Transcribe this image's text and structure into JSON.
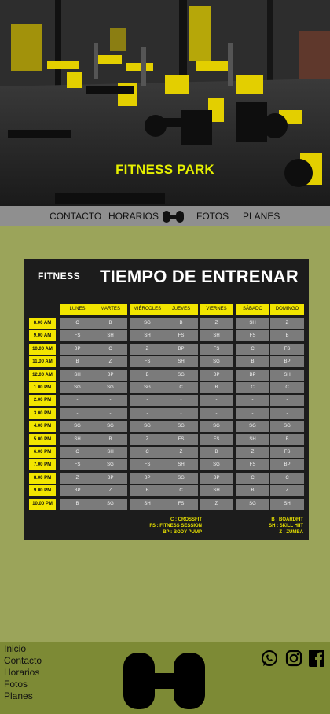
{
  "hero": {
    "title": "FITNESS PARK"
  },
  "nav": {
    "items": [
      "CONTACTO",
      "HORARIOS",
      "FOTOS",
      "PLANES"
    ],
    "logo_icon": "dumbbell-icon"
  },
  "schedule": {
    "brand": "FITNESS",
    "title": "TIEMPO DE ENTRENAR",
    "days": [
      "LUNES",
      "MARTES",
      "MIÉRCOLES",
      "JUEVES",
      "VIERNES",
      "SÁBADO",
      "DOMINGO"
    ],
    "times": [
      "8.00 AM",
      "9.00 AM",
      "10.00 AM",
      "11.00 AM",
      "12.00 AM",
      "1.00 PM",
      "2.00 PM",
      "3.00 PM",
      "4.00 PM",
      "5.00 PM",
      "6.00 PM",
      "7.00 PM",
      "8.00 PM",
      "9.00 PM",
      "10.00 PM"
    ],
    "rows": [
      [
        "C",
        "B",
        "SG",
        "B",
        "Z",
        "SH",
        "Z"
      ],
      [
        "FS",
        "SH",
        "SH",
        "FS",
        "SH",
        "FS",
        "B"
      ],
      [
        "BP",
        "C",
        "Z",
        "BP",
        "FS",
        "C",
        "FS"
      ],
      [
        "B",
        "Z",
        "FS",
        "SH",
        "SG",
        "B",
        "BP"
      ],
      [
        "SH",
        "BP",
        "B",
        "SG",
        "BP",
        "BP",
        "SH"
      ],
      [
        "SG",
        "SG",
        "SG",
        "C",
        "B",
        "C",
        "C"
      ],
      [
        "-",
        "-",
        "-",
        "-",
        "-",
        "-",
        "-"
      ],
      [
        "-",
        "-",
        "-",
        "-",
        "-",
        "-",
        "-"
      ],
      [
        "SG",
        "SG",
        "SG",
        "SG",
        "SG",
        "SG",
        "SG"
      ],
      [
        "SH",
        "B",
        "Z",
        "FS",
        "FS",
        "SH",
        "B"
      ],
      [
        "C",
        "SH",
        "C",
        "Z",
        "B",
        "Z",
        "FS"
      ],
      [
        "FS",
        "SG",
        "FS",
        "SH",
        "SG",
        "FS",
        "BP"
      ],
      [
        "Z",
        "BP",
        "BP",
        "SG",
        "BP",
        "C",
        "C"
      ],
      [
        "BP",
        "Z",
        "B",
        "C",
        "SH",
        "B",
        "Z"
      ],
      [
        "B",
        "SG",
        "SH",
        "FS",
        "Z",
        "SG",
        "SH"
      ]
    ],
    "legend_left": [
      "C : CROSSFIT",
      "FS : FITNESS SESSION",
      "BP : BODY PUMP"
    ],
    "legend_right": [
      "B : BOARDFIT",
      "SH : SKILL HIIT",
      "Z : ZUMBA"
    ]
  },
  "footer": {
    "links": [
      "Inicio",
      "Contacto",
      "Horarios",
      "Fotos",
      "Planes"
    ],
    "social_icons": [
      "whatsapp-icon",
      "instagram-icon",
      "facebook-icon"
    ]
  },
  "colors": {
    "accent": "#f2e500",
    "page_bg": "#9ba45a",
    "footer_bg": "#7d8a35",
    "nav_bg": "#8f8f8f"
  }
}
